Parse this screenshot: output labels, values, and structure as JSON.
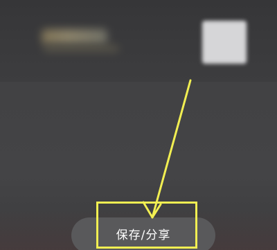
{
  "screen": {
    "blurred_title_icon": "blurred-text",
    "thumbnail_icon": "blurred-image"
  },
  "actions": {
    "save_share_label": "保存/分享"
  },
  "annotation": {
    "highlight_color": "#f2ef52",
    "arrow_color": "#f2ef52",
    "arrow_icon": "arrow-pointer"
  }
}
